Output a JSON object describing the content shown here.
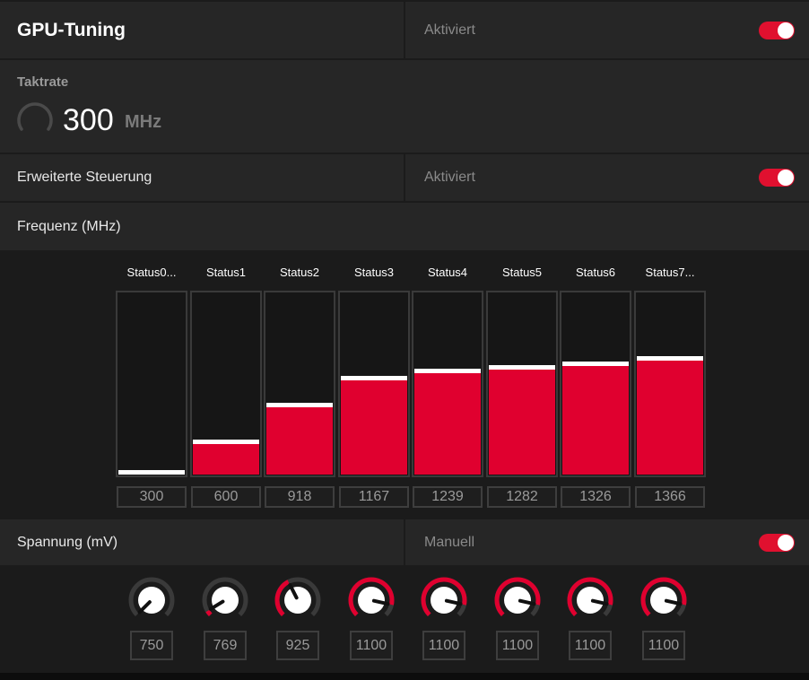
{
  "header": {
    "title": "GPU-Tuning",
    "status": "Aktiviert",
    "toggle_on": true
  },
  "clock": {
    "label": "Taktrate",
    "value": "300",
    "unit": "MHz"
  },
  "advanced": {
    "label": "Erweiterte Steuerung",
    "status": "Aktiviert",
    "toggle_on": true
  },
  "frequency": {
    "label": "Frequenz (MHz)",
    "min": 300,
    "max": 1366,
    "states": [
      {
        "label": "Status0...",
        "value": "300",
        "fraction": 0.0
      },
      {
        "label": "Status1",
        "value": "600",
        "fraction": 0.17
      },
      {
        "label": "Status2",
        "value": "918",
        "fraction": 0.37
      },
      {
        "label": "Status3",
        "value": "1167",
        "fraction": 0.52
      },
      {
        "label": "Status4",
        "value": "1239",
        "fraction": 0.56
      },
      {
        "label": "Status5",
        "value": "1282",
        "fraction": 0.58
      },
      {
        "label": "Status6",
        "value": "1326",
        "fraction": 0.6
      },
      {
        "label": "Status7...",
        "value": "1366",
        "fraction": 0.63
      }
    ]
  },
  "voltage": {
    "label": "Spannung (mV)",
    "mode": "Manuell",
    "toggle_on": true,
    "knobs": [
      {
        "value": "750",
        "fraction": 0.0
      },
      {
        "value": "769",
        "fraction": 0.05
      },
      {
        "value": "925",
        "fraction": 0.4
      },
      {
        "value": "1100",
        "fraction": 0.88
      },
      {
        "value": "1100",
        "fraction": 0.88
      },
      {
        "value": "1100",
        "fraction": 0.88
      },
      {
        "value": "1100",
        "fraction": 0.88
      },
      {
        "value": "1100",
        "fraction": 0.88
      }
    ]
  },
  "colors": {
    "accent": "#e0002f",
    "panel": "#262626",
    "background": "#1b1b1b",
    "muted_text": "#8a8a8a"
  }
}
